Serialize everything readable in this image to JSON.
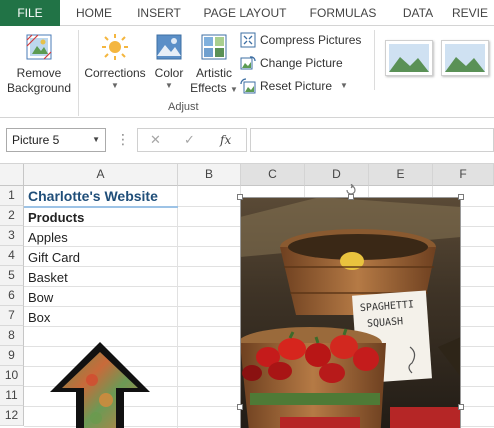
{
  "ribbon_tabs": [
    "FILE",
    "HOME",
    "INSERT",
    "PAGE LAYOUT",
    "FORMULAS",
    "DATA",
    "REVIE"
  ],
  "ribbon": {
    "remove_background": "Remove Background",
    "remove_background_l1": "Remove",
    "remove_background_l2": "Background",
    "corrections": "Corrections",
    "color": "Color",
    "artistic_effects_l1": "Artistic",
    "artistic_effects_l2": "Effects",
    "compress_pictures": "Compress Pictures",
    "change_picture": "Change Picture",
    "reset_picture": "Reset Picture",
    "group_adjust": "Adjust"
  },
  "formula_bar": {
    "name_box": "Picture 5",
    "cancel": "✕",
    "enter": "✓",
    "fx": "fx",
    "formula": ""
  },
  "columns": [
    "A",
    "B",
    "C",
    "D",
    "E",
    "F"
  ],
  "rows": [
    "1",
    "2",
    "3",
    "4",
    "5",
    "6",
    "7",
    "8",
    "9",
    "10",
    "11",
    "12"
  ],
  "cells": {
    "A1": "Charlotte's Website",
    "A2": "Products",
    "A3": "Apples",
    "A4": "Gift Card",
    "A5": "Basket",
    "A6": "Bow",
    "A7": "Box"
  },
  "picture_text": {
    "line1": "SPAGHETTI",
    "line2": "SQUASH"
  },
  "colors": {
    "file_tab": "#217346",
    "title_text": "#1f4e79",
    "header_bg": "#f3f3f3"
  }
}
